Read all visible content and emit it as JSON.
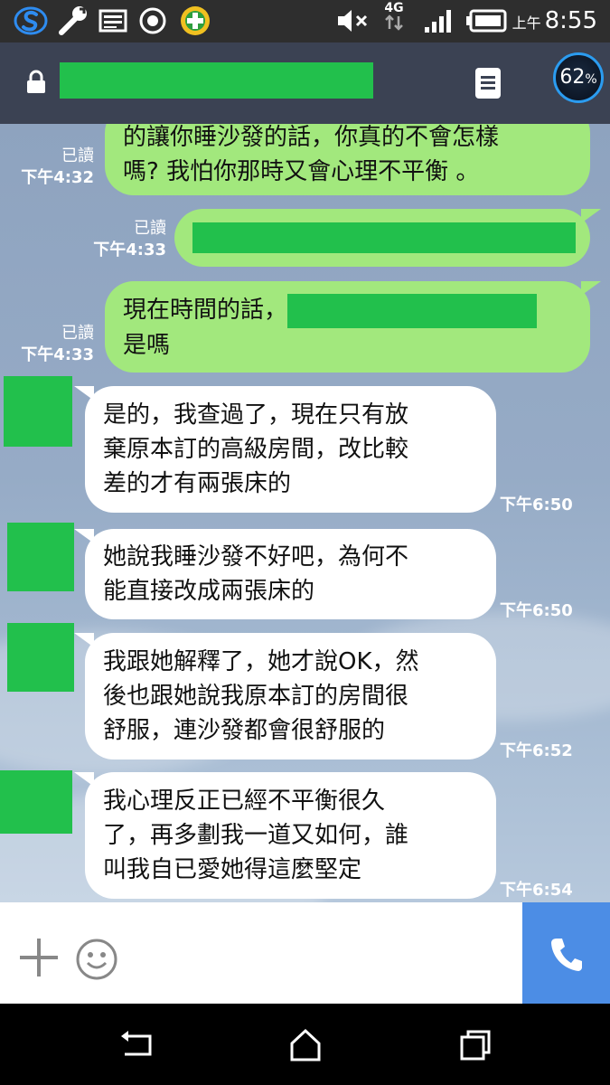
{
  "status_bar": {
    "time_prefix": "上午",
    "time": "8:55",
    "network": "4G",
    "icons": [
      "s-app-icon",
      "wrench-icon",
      "gallery-icon",
      "record-icon",
      "plus-app-icon",
      "mute-icon",
      "signal-icon",
      "battery-icon"
    ]
  },
  "header": {
    "lock_icon": "lock-icon",
    "menu_icon": "notes-icon",
    "badge_value": "62",
    "badge_unit": "%"
  },
  "messages": [
    {
      "side": "out",
      "lines": [
        "的讓你睡沙發的話，你真的不會怎樣",
        "嗎? 我怕你那時又會心理不平衡 。"
      ],
      "read": "已讀",
      "time": "下午4:32"
    },
    {
      "side": "out",
      "lines": [
        ""
      ],
      "read": "已讀",
      "time": "下午4:33"
    },
    {
      "side": "out",
      "lines": [
        "現在時間的話，",
        "是嗎"
      ],
      "read": "已讀",
      "time": "下午4:33"
    },
    {
      "side": "in",
      "lines": [
        "是的，我查過了，現在只有放",
        "棄原本訂的高級房間，改比較",
        "差的才有兩張床的"
      ],
      "time": "下午6:50"
    },
    {
      "side": "in",
      "lines": [
        "她說我睡沙發不好吧，為何不",
        "能直接改成兩張床的"
      ],
      "time": "下午6:50"
    },
    {
      "side": "in",
      "lines": [
        "我跟她解釋了，她才說OK，然",
        "後也跟她說我原本訂的房間很",
        "舒服，連沙發都會很舒服的"
      ],
      "time": "下午6:52"
    },
    {
      "side": "in",
      "lines": [
        "我心理反正已經不平衡很久",
        "了，再多劃我一道又如何，誰",
        "叫我自已愛她得這麼堅定"
      ],
      "time": "下午6:54"
    }
  ],
  "input_bar": {
    "plus_icon": "plus-icon",
    "emoji_icon": "emoji-icon",
    "call_icon": "phone-icon"
  },
  "nav_bar": {
    "icons": [
      "back-icon",
      "home-icon",
      "recents-icon"
    ]
  },
  "colors": {
    "outgoing": "#a2e87d",
    "incoming": "#ffffff",
    "redaction": "#22c04c",
    "header": "#3b4253",
    "call": "#4c8de5"
  }
}
